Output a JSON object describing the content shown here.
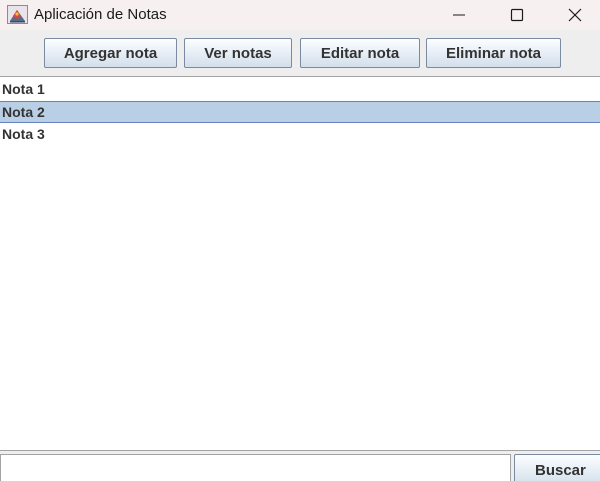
{
  "window": {
    "title": "Aplicación de Notas",
    "app_icon": "java-cup-icon",
    "controls": {
      "minimize_icon": "minimize-icon",
      "maximize_icon": "maximize-icon",
      "close_icon": "close-icon"
    }
  },
  "toolbar": {
    "buttons": [
      {
        "label": "Agregar nota"
      },
      {
        "label": "Ver notas"
      },
      {
        "label": "Editar nota"
      },
      {
        "label": "Eliminar nota"
      }
    ]
  },
  "notes_list": {
    "items": [
      {
        "label": "Nota 1"
      },
      {
        "label": "Nota 2"
      },
      {
        "label": "Nota 3"
      }
    ],
    "selected_index": 1
  },
  "search": {
    "value": "",
    "button_label": "Buscar"
  },
  "colors": {
    "titlebar_bg": "#f7f0f0",
    "window_bg": "#eeeeee",
    "selection_bg": "#b8cfe5",
    "selection_border": "#6382bf",
    "button_border": "#7a8aa0",
    "text": "#333333"
  }
}
